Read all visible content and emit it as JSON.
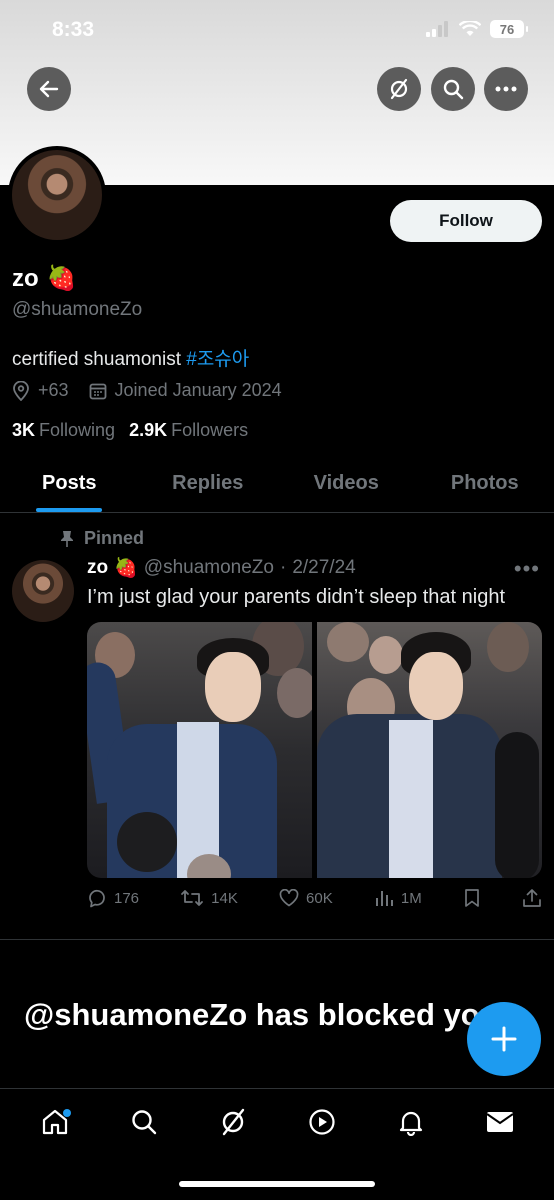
{
  "status_bar": {
    "time": "8:33",
    "battery": "76"
  },
  "header": {
    "back_icon": "arrow-left-icon",
    "grok_icon": "grok-icon",
    "search_icon": "search-icon",
    "more_icon": "more-horizontal-icon"
  },
  "profile": {
    "display_name": "zo",
    "name_emoji": "🍓",
    "handle": "@shuamoneZo",
    "bio_text": "certified shuamonist ",
    "bio_hashtag": "#조슈아",
    "location": "+63",
    "joined": "Joined January 2024",
    "following_count": "3K",
    "following_label": "Following",
    "followers_count": "2.9K",
    "followers_label": "Followers",
    "follow_label": "Follow"
  },
  "tabs": [
    {
      "label": "Posts",
      "active": true
    },
    {
      "label": "Replies",
      "active": false
    },
    {
      "label": "Videos",
      "active": false
    },
    {
      "label": "Photos",
      "active": false
    }
  ],
  "post": {
    "pinned_label": "Pinned",
    "author_name": "zo",
    "author_emoji": "🍓",
    "author_handle": "@shuamoneZo",
    "separator": "·",
    "date": "2/27/24",
    "text": "I’m just glad your parents didn’t sleep that night",
    "replies": "176",
    "reposts": "14K",
    "likes": "60K",
    "views": "1M"
  },
  "blocked_message": "@shuamoneZo has blocked you",
  "colors": {
    "accent": "#1d9bf0",
    "background": "#000000",
    "muted": "#71767b"
  }
}
